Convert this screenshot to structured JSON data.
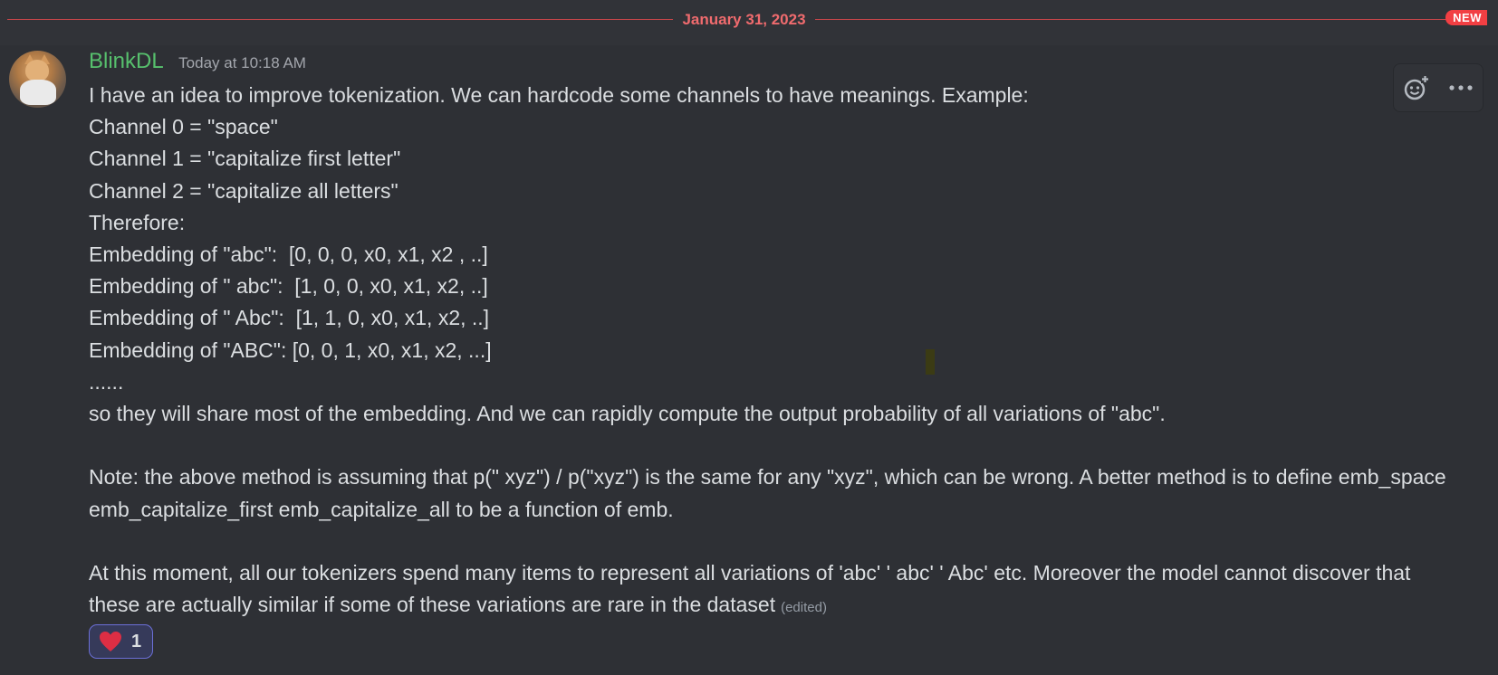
{
  "divider": {
    "date": "January 31, 2023",
    "badge": "NEW"
  },
  "message": {
    "author": "BlinkDL",
    "timestamp": "Today at 10:18 AM",
    "author_color": "#57c06d",
    "lines": [
      "I have an idea to improve tokenization. We can hardcode some channels to have meanings. Example:",
      "Channel 0 = \"space\"",
      "Channel 1 = \"capitalize first letter\"",
      "Channel 2 = \"capitalize all letters\"",
      "Therefore:",
      "Embedding of \"abc\":  [0, 0, 0, x0, x1, x2 , ..]",
      "Embedding of \" abc\":  [1, 0, 0, x0, x1, x2, ..]",
      "Embedding of \" Abc\":  [1, 1, 0, x0, x1, x2, ..]",
      "Embedding of \"ABC\": [0, 0, 1, x0, x1, x2, ...]",
      "......",
      "so they will share most of the embedding. And we can rapidly compute the output probability of all variations of \"abc\".",
      "",
      "Note: the above method is assuming that p(\" xyz\") / p(\"xyz\") is the same for any \"xyz\", which can be wrong. A better method is to define emb_space emb_capitalize_first emb_capitalize_all to be a function of emb.",
      "",
      "At this moment, all our tokenizers spend many items to represent all variations of 'abc' ' abc' ' Abc' etc. Moreover the model cannot discover that these are actually similar if some of these variations are rare in the dataset"
    ],
    "edited_label": "(edited)",
    "reaction": {
      "emoji": "heart-icon",
      "count": "1",
      "color": "#dd2e44"
    }
  },
  "toolbar": {
    "icons": [
      "add-reaction-icon",
      "more-options-icon"
    ]
  },
  "colors": {
    "background": "#313338",
    "divider": "#f06b6e",
    "badge": "#f23f43"
  }
}
